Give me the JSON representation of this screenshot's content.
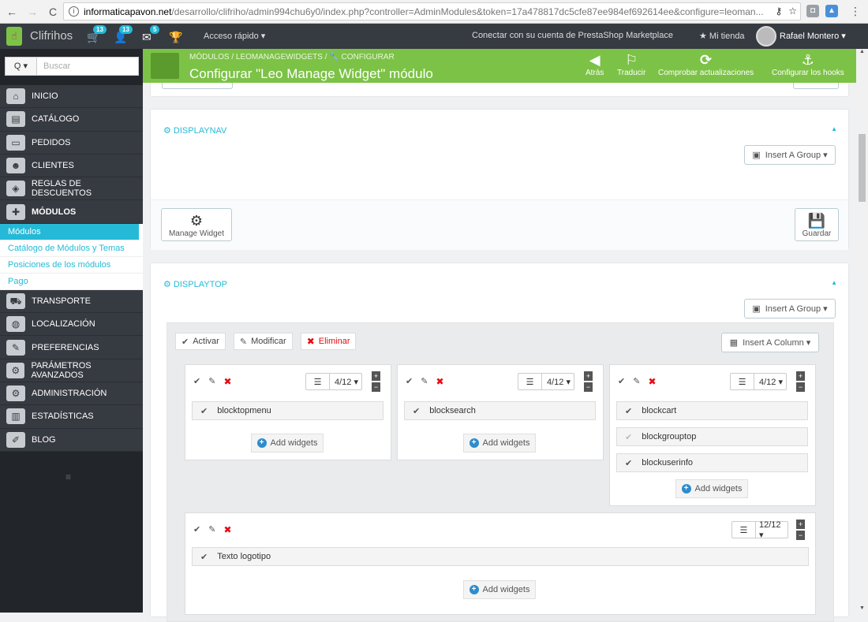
{
  "browser": {
    "url_host": "informaticapavon.net",
    "url_path": "/desarrollo/clifriho/admin994chu6y0/index.php?controller=AdminModules&token=17a478817dc5cfe87ee984ef692614ee&configure=leoman..."
  },
  "topbar": {
    "brand": "Clifrihos",
    "badges": [
      "13",
      "13",
      "5"
    ],
    "quick_access": "Acceso rápido ▾",
    "marketplace": "Conectar con su cuenta de PrestaShop Marketplace",
    "my_shop": "★ Mi tienda",
    "user_name": "Rafael Montero ▾"
  },
  "search": {
    "button": "Q ▾",
    "placeholder": "Buscar"
  },
  "sidebar": {
    "items_top": [
      {
        "label": "Inicio",
        "icon": "home-icon"
      },
      {
        "label": "Catálogo",
        "icon": "book-icon"
      },
      {
        "label": "Pedidos",
        "icon": "credit-card-icon"
      },
      {
        "label": "Clientes",
        "icon": "users-icon"
      },
      {
        "label": "Reglas de descuentos",
        "icon": "tag-icon"
      },
      {
        "label": "Módulos",
        "icon": "puzzle-icon"
      }
    ],
    "submenu": [
      "Módulos",
      "Catálogo de Módulos y Temas",
      "Posiciones de los módulos",
      "Pago"
    ],
    "items_bottom": [
      {
        "label": "Transporte",
        "icon": "truck-icon"
      },
      {
        "label": "Localización",
        "icon": "globe-icon"
      },
      {
        "label": "Preferencias",
        "icon": "wrench-icon"
      },
      {
        "label": "Parámetros avanzados",
        "icon": "cogs-icon"
      },
      {
        "label": "Administración",
        "icon": "gear-icon"
      },
      {
        "label": "Estadísticas",
        "icon": "bar-chart-icon"
      },
      {
        "label": "Blog",
        "icon": "pencil-icon"
      }
    ],
    "collapse": "≡"
  },
  "header": {
    "breadcrumb": "MÓDULOS  /  LEOMANAGEWIDGETS  /  🔧 CONFIGURAR",
    "title": "Configurar \"Leo Manage Widget\" módulo",
    "toolbar": [
      {
        "label": "Atrás",
        "glyph": "◀"
      },
      {
        "label": "Traducir",
        "glyph": "⚐"
      },
      {
        "label": "Comprobar actualizaciones",
        "glyph": "⟳"
      },
      {
        "label": "Configurar los hooks",
        "glyph": "⚓"
      }
    ]
  },
  "displaynav": {
    "title": "⚙ DISPLAYNAV",
    "insert_group": "Insert A Group ▾",
    "manage_widget": "Manage Widget",
    "save": "Guardar"
  },
  "displaytop": {
    "title": "⚙ DISPLAYTOP",
    "insert_group": "Insert A Group ▾",
    "group_actions": {
      "activate": "Activar",
      "modify": "Modificar",
      "delete": "Eliminar"
    },
    "insert_column": "Insert A Column ▾",
    "add_widgets": "Add widgets",
    "columns": [
      {
        "width": "4/12 ▾",
        "widgets": [
          {
            "name": "blocktopmenu",
            "active": true
          }
        ]
      },
      {
        "width": "4/12 ▾",
        "widgets": [
          {
            "name": "blocksearch",
            "active": true
          }
        ]
      },
      {
        "width": "4/12 ▾",
        "widgets": [
          {
            "name": "blockcart",
            "active": true
          },
          {
            "name": "blockgrouptop",
            "active": false
          },
          {
            "name": "blockuserinfo",
            "active": true
          }
        ]
      },
      {
        "width": "12/12 ▾",
        "widgets": [
          {
            "name": "Texto logotipo",
            "active": true
          }
        ]
      }
    ]
  }
}
